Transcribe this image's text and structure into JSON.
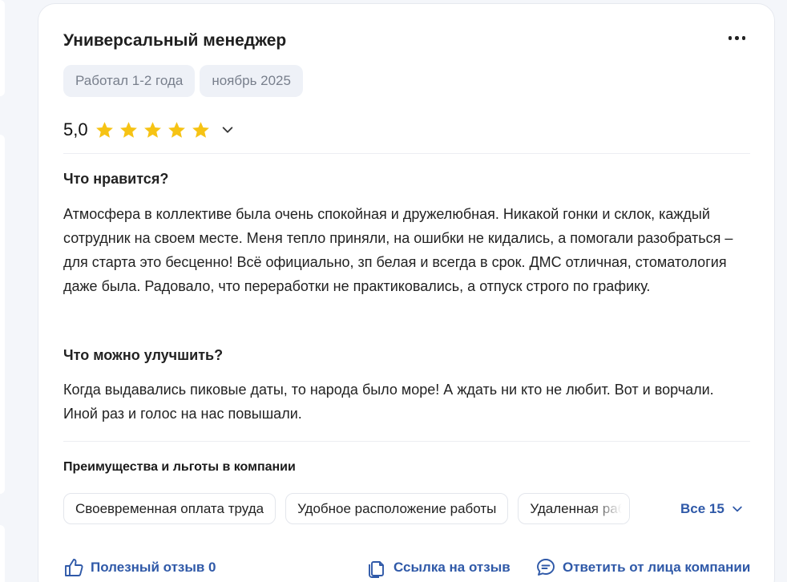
{
  "review": {
    "title": "Универсальный менеджер",
    "experience": "Работал 1-2 года",
    "date": "ноябрь 2025",
    "rating": "5,0",
    "stars": 5,
    "likes_heading": "Что нравится?",
    "likes_text": "Атмосфера в коллективе была очень спокойная и дружелюбная. Никакой гонки и склок, каждый сотрудник на своем месте. Меня тепло приняли, на ошибки не кидались, а помогали разобраться – для старта это бесценно! Всё официально, зп белая и всегда в срок. ДМС отличная, стоматология даже была. Радовало, что переработки не практиковались, а отпуск строго по графику.",
    "improve_heading": "Что можно улучшить?",
    "improve_text": "Когда выдавались пиковые даты, то народа было море! А ждать ни кто не любит. Вот и ворчали. Иной раз и голос на нас повышали."
  },
  "benefits": {
    "heading": "Преимущества и льготы в компании",
    "items": [
      "Своевременная оплата труда",
      "Удобное расположение работы",
      "Удаленная работа"
    ],
    "all_label": "Все 15"
  },
  "actions": {
    "helpful": "Полезный отзыв 0",
    "link": "Ссылка на отзыв",
    "reply": "Ответить от лица компании"
  },
  "colors": {
    "accent": "#2f59a8",
    "star": "#f6c314",
    "chip_bg": "#eef1f7"
  }
}
